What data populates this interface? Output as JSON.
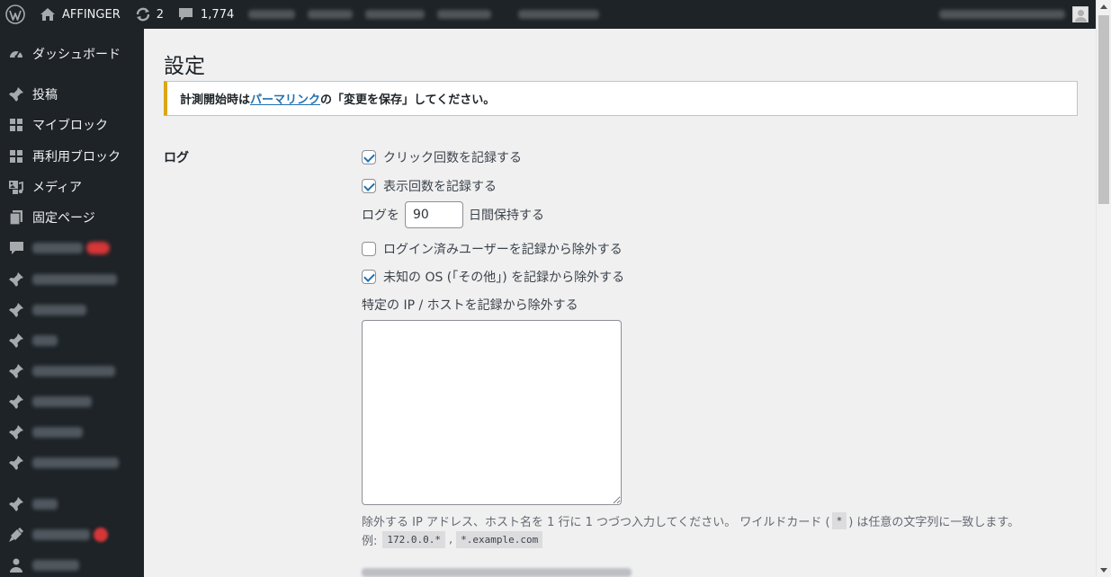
{
  "adminbar": {
    "site_name": "AFFINGER",
    "updates_count": "2",
    "comments_count": "1,774"
  },
  "sidebar": {
    "items": [
      {
        "label": "ダッシュボード",
        "icon": "dashboard-icon"
      },
      {
        "label": "投稿",
        "icon": "pin-icon"
      },
      {
        "label": "マイブロック",
        "icon": "grid-icon"
      },
      {
        "label": "再利用ブロック",
        "icon": "grid-icon"
      },
      {
        "label": "メディア",
        "icon": "media-icon"
      },
      {
        "label": "固定ページ",
        "icon": "pages-icon"
      }
    ]
  },
  "page": {
    "title": "設定",
    "notice": {
      "prefix": "計測開始時は",
      "link": "パーマリンク",
      "suffix": "の「変更を保存」してください。"
    },
    "log_section": {
      "label": "ログ",
      "record_clicks": {
        "label": "クリック回数を記録する",
        "checked": true
      },
      "record_views": {
        "label": "表示回数を記録する",
        "checked": true
      },
      "retention_prefix": "ログを",
      "retention_value": "90",
      "retention_suffix": "日間保持する",
      "exclude_logged_in": {
        "label": "ログイン済みユーザーを記録から除外する",
        "checked": false
      },
      "exclude_unknown_os": {
        "label": "未知の OS (「その他」) を記録から除外する",
        "checked": true
      },
      "exclude_ip_label": "特定の IP / ホストを記録から除外する",
      "exclude_ip_value": "",
      "description_1a": "除外する IP アドレス、ホスト名を 1 行に 1 つづつ入力してください。 ワイルドカード (",
      "wildcard": "*",
      "description_1b": ") は任意の文字列に一致します。",
      "example_label": "例:",
      "example_1": "172.0.0.*",
      "example_sep": ",",
      "example_2": "*.example.com"
    }
  }
}
